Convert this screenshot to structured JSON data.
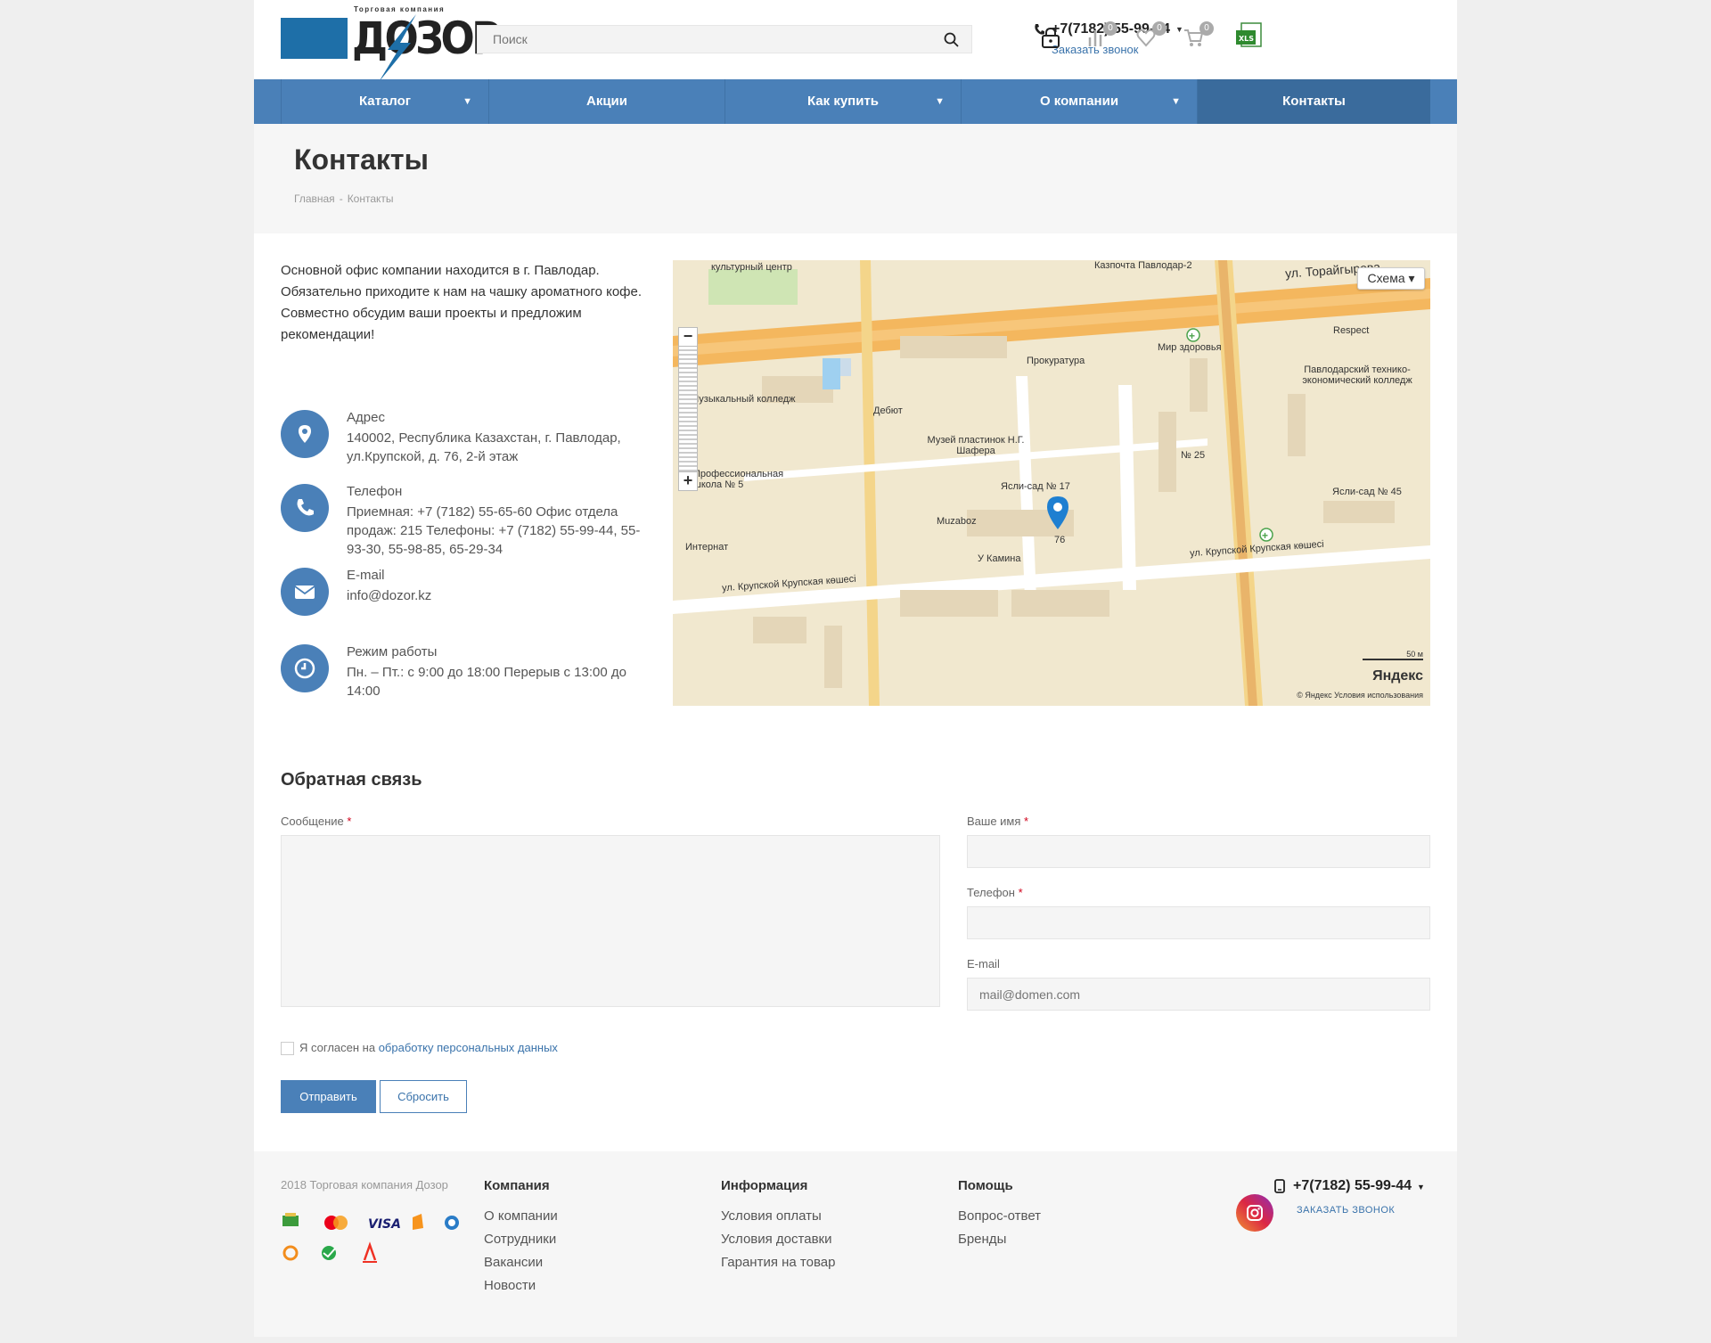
{
  "header": {
    "logo_tagline": "Торговая компания",
    "logo_text": "ДОЗОР",
    "search_placeholder": "Поиск",
    "phone": "+7(7182) 55-99-44",
    "callback": "Заказать звонок",
    "compare_count": "0",
    "favorites_count": "0",
    "cart_count": "0"
  },
  "nav": [
    {
      "label": "Каталог",
      "has_dropdown": true
    },
    {
      "label": "Акции",
      "has_dropdown": false
    },
    {
      "label": "Как купить",
      "has_dropdown": true
    },
    {
      "label": "О компании",
      "has_dropdown": true
    },
    {
      "label": "Контакты",
      "has_dropdown": false,
      "active": true
    }
  ],
  "page": {
    "title": "Контакты",
    "breadcrumb": [
      "Главная",
      "Контакты"
    ],
    "breadcrumb_sep": "-"
  },
  "intro": [
    "Основной офис компании находится в г. Павлодар.",
    "Обязательно приходите к нам на чашку ароматного кофе.",
    "Совместно обсудим ваши проекты и предложим рекомендации!"
  ],
  "contacts": {
    "address_label": "Адрес",
    "address_value": "140002, Республика Казахстан, г. Павлодар, ул.Крупской, д. 76, 2-й этаж",
    "phone_label": "Телефон",
    "phone_value": "Приемная: +7 (7182) 55-65-60 Офис отдела продаж: 215 Телефоны: +7 (7182) 55-99-44, 55-93-30, 55-98-85, 65-29-34",
    "email_label": "E-mail",
    "email_value": "info@dozor.kz",
    "hours_label": "Режим работы",
    "hours_value": "Пн. – Пт.: с 9:00 до 18:00 Перерыв с 13:00 до 14:00"
  },
  "map": {
    "layer_button": "Схема ▾",
    "zoom_in": "+",
    "zoom_out": "−",
    "brand": "Яндекс",
    "copyright": "© Яндекс  Условия использования",
    "scale": "50 м",
    "labels": {
      "street1": "ул. Торайгырова",
      "street2": "ул. Крупской Крупская көшесі",
      "street3": "ул. Крупской Крупская көшесі",
      "kazpochta": "Казпочта Павлодар-2",
      "culture": "культурный центр",
      "music": "Музыкальный колледж",
      "debut": "Дебют",
      "prokuratura": "Прокуратура",
      "mir": "Мир здоровья",
      "respect": "Respect",
      "college": "Павлодарский технико-экономический колледж",
      "museum": "Музей пластинок Н.Г. Шафера",
      "yasli17": "Ясли-сад № 17",
      "n25": "№ 25",
      "school5": "Профессиональная школа № 5",
      "muzaboz": "Muzaboz",
      "ukamina": "У Камина",
      "internat": "Интернат",
      "yasli45": "Ясли-сад № 45",
      "b76": "76"
    }
  },
  "form": {
    "title": "Обратная связь",
    "message_label": "Сообщение",
    "name_label": "Ваше имя",
    "phone_label": "Телефон",
    "email_label": "E-mail",
    "email_placeholder": "mail@domen.com",
    "required_mark": "*",
    "consent_text": "Я согласен на",
    "consent_link": "обработку персональных данных",
    "submit": "Отправить",
    "reset": "Сбросить"
  },
  "footer": {
    "copyright": "2018 Торговая компания Дозор",
    "columns": [
      {
        "title": "Компания",
        "links": [
          "О компании",
          "Сотрудники",
          "Вакансии",
          "Новости"
        ]
      },
      {
        "title": "Информация",
        "links": [
          "Условия оплаты",
          "Условия доставки",
          "Гарантия на товар"
        ]
      },
      {
        "title": "Помощь",
        "links": [
          "Вопрос-ответ",
          "Бренды"
        ]
      }
    ],
    "phone": "+7(7182) 55-99-44",
    "callback": "ЗАКАЗАТЬ ЗВОНОК",
    "payment_visa": "VISA"
  },
  "colors": {
    "accent": "#4a80b8",
    "nav_active": "#3a6b9c",
    "link": "#3a73ab"
  }
}
